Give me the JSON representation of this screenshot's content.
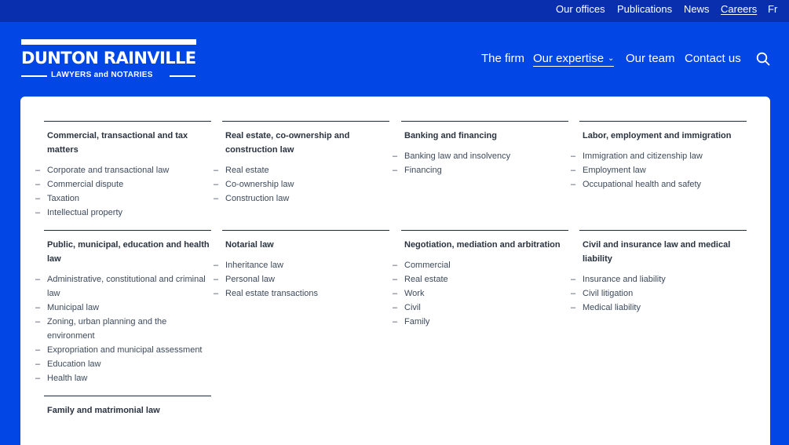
{
  "topnav": [
    {
      "label": "Our offices",
      "underlined": false
    },
    {
      "label": "Publications",
      "underlined": false
    },
    {
      "label": "News",
      "underlined": false
    },
    {
      "label": "Careers",
      "underlined": true
    },
    {
      "label": "Fr",
      "underlined": false
    }
  ],
  "logo": {
    "name": "DUNTON RAINVILLE",
    "tagline": "LAWYERS and NOTARIES"
  },
  "mainnav": [
    {
      "label": "The firm",
      "active": false
    },
    {
      "label": "Our expertise",
      "active": true,
      "dropdown": true
    },
    {
      "label": "Our team",
      "active": false
    },
    {
      "label": "Contact us",
      "active": false
    }
  ],
  "search_icon": "search-icon",
  "colors": {
    "brand_blue": "#0346e6",
    "topbar_blue": "#0a2fae",
    "heading_text": "#2a3340",
    "body_text": "#3d4a5c"
  },
  "expertise": [
    {
      "title": "Commercial, transactional and tax matters",
      "items": [
        "Corporate and transactional law",
        "Commercial dispute",
        "Taxation",
        "Intellectual property"
      ]
    },
    {
      "title": "Real estate, co-ownership and construction law",
      "items": [
        "Real estate",
        "Co-ownership law",
        "Construction law"
      ]
    },
    {
      "title": "Banking and financing",
      "items": [
        "Banking law and insolvency",
        "Financing"
      ]
    },
    {
      "title": "Labor, employment and immigration",
      "items": [
        "Immigration and citizenship law",
        "Employment law",
        "Occupational health and safety"
      ]
    },
    {
      "title": "Public, municipal, education and health law",
      "items": [
        "Administrative, constitutional and criminal law",
        "Municipal law",
        "Zoning, urban planning and the environment",
        "Expropriation and municipal assessment",
        "Education law",
        "Health law"
      ]
    },
    {
      "title": "Notarial law",
      "items": [
        "Inheritance law",
        "Personal law",
        "Real estate transactions"
      ]
    },
    {
      "title": "Negotiation, mediation and arbitration",
      "items": [
        "Commercial",
        "Real estate",
        "Work",
        "Civil",
        "Family"
      ]
    },
    {
      "title": "Civil and insurance law and medical liability",
      "items": [
        "Insurance and liability",
        "Civil litigation",
        "Medical liability"
      ]
    },
    {
      "title": "Family and matrimonial law",
      "items": []
    }
  ]
}
